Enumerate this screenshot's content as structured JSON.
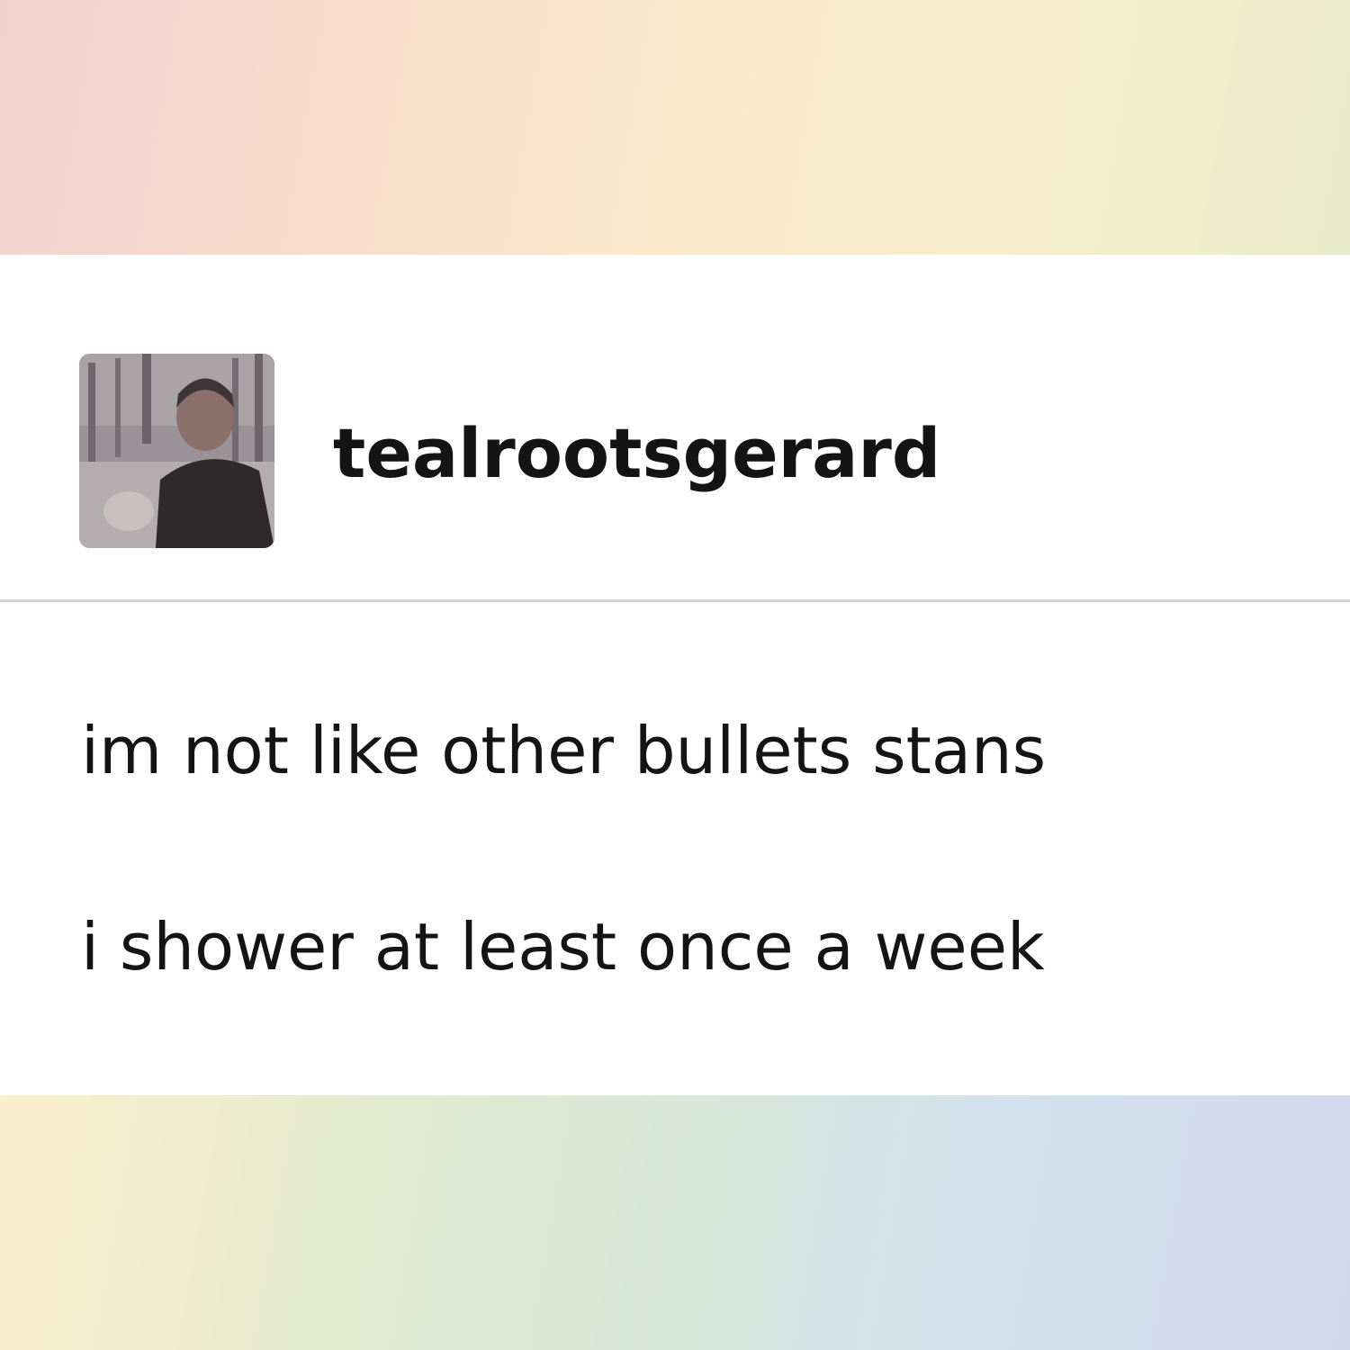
{
  "post": {
    "username": "tealrootsgerard",
    "avatar_icon": "user-avatar-photo",
    "lines": [
      "im not like other bullets stans",
      "i shower at least once a week"
    ]
  },
  "colors": {
    "text": "#141414",
    "card_background": "#ffffff",
    "divider": "#d4d4d4"
  }
}
